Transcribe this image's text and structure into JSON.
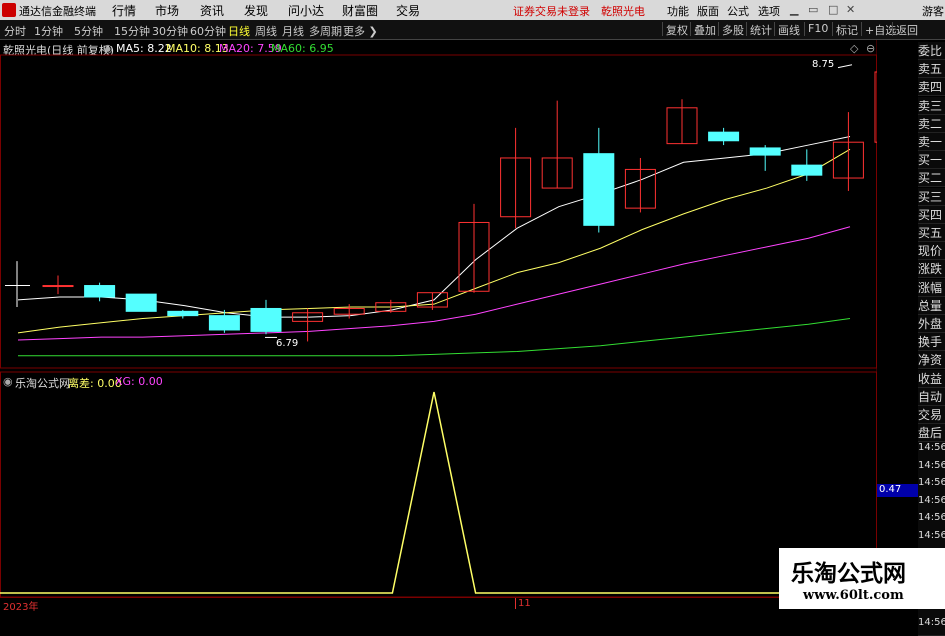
{
  "titlebar": {
    "app_name": "通达信金融终端",
    "menu": [
      "行情",
      "市场",
      "资讯",
      "发现",
      "问小达",
      "财富圈",
      "交易"
    ],
    "notice": "证券交易未登录",
    "stock_name": "乾照光电",
    "right_menu": [
      "功能",
      "版面",
      "公式",
      "选项"
    ],
    "guest": "游客"
  },
  "toolbar": {
    "periods": [
      "分时",
      "1分钟",
      "5分钟",
      "15分钟",
      "30分钟",
      "60分钟",
      "日线",
      "周线",
      "月线",
      "多周期",
      "更多"
    ],
    "active_period": "日线",
    "right_buttons": [
      "复权",
      "叠加",
      "多股",
      "统计",
      "画线",
      "F10",
      "标记",
      "+自选",
      "返回"
    ]
  },
  "main_chart": {
    "title": "乾照光电(日线 前复权)",
    "ma": [
      {
        "label": "MA5: 8.22",
        "color": "#ffffff"
      },
      {
        "label": "MA10: 8.13",
        "color": "#ffff66"
      },
      {
        "label": "MA20: 7.59",
        "color": "#ff44ff"
      },
      {
        "label": "MA60: 6.95",
        "color": "#33dd33"
      }
    ],
    "high_label": "8.75",
    "low_label": "6.79"
  },
  "sub_chart": {
    "title": "乐淘公式网",
    "values": [
      {
        "label": "离差: 0.00",
        "color": "#ffff66"
      },
      {
        "label": "XG: 0.00",
        "color": "#ff44ff"
      }
    ],
    "current_value": "0.47"
  },
  "right_panel": {
    "items": [
      "委比",
      "卖五",
      "卖四",
      "卖三",
      "卖二",
      "卖一",
      "买一",
      "买二",
      "买三",
      "买四",
      "买五",
      "现价",
      "涨跌",
      "涨幅",
      "总量",
      "外盘",
      "换手",
      "净资",
      "收益",
      "自动",
      "交易",
      "盘后",
      "14:56",
      "14:56",
      "14:56",
      "14:56",
      "14:56",
      "14:56",
      "14:56",
      "14:56",
      "14:56",
      "14:56",
      "14:56"
    ]
  },
  "watermark": {
    "title": "乐淘公式网",
    "url": "www.60lt.com"
  },
  "dates": {
    "start": "2023年",
    "mid": "11"
  },
  "chart_data": [
    {
      "type": "candlestick",
      "title": "乾照光电(日线 前复权)",
      "ylim": [
        6.7,
        8.8
      ],
      "yticks": [
        "8.60",
        "8.40",
        "8.20",
        "8.00",
        "7.80",
        "7.60",
        "7.40",
        "7.20",
        "7.00",
        "6.80"
      ],
      "yvals": [
        8.6,
        8.4,
        8.2,
        8.0,
        7.8,
        7.6,
        7.4,
        7.2,
        7.0,
        6.8
      ],
      "candles": [
        {
          "o": 7.18,
          "c": 7.18,
          "h": 7.25,
          "l": 7.12
        },
        {
          "o": 7.18,
          "c": 7.1,
          "h": 7.2,
          "l": 7.07
        },
        {
          "o": 7.12,
          "c": 7.0,
          "h": 7.12,
          "l": 7.0
        },
        {
          "o": 7.0,
          "c": 6.97,
          "h": 7.01,
          "l": 6.95
        },
        {
          "o": 6.97,
          "c": 6.87,
          "h": 7.01,
          "l": 6.85
        },
        {
          "o": 7.02,
          "c": 6.86,
          "h": 7.08,
          "l": 6.84
        },
        {
          "o": 6.93,
          "c": 6.99,
          "h": 7.02,
          "l": 6.79
        },
        {
          "o": 6.98,
          "c": 7.02,
          "h": 7.05,
          "l": 6.95
        },
        {
          "o": 7.0,
          "c": 7.06,
          "h": 7.08,
          "l": 6.99
        },
        {
          "o": 7.03,
          "c": 7.13,
          "h": 7.13,
          "l": 7.01
        },
        {
          "o": 7.14,
          "c": 7.62,
          "h": 7.75,
          "l": 7.13
        },
        {
          "o": 7.66,
          "c": 8.07,
          "h": 8.28,
          "l": 7.58
        },
        {
          "o": 7.86,
          "c": 8.07,
          "h": 8.47,
          "l": 7.86
        },
        {
          "o": 8.1,
          "c": 7.6,
          "h": 8.28,
          "l": 7.55
        },
        {
          "o": 7.72,
          "c": 7.99,
          "h": 8.07,
          "l": 7.69
        },
        {
          "o": 8.17,
          "c": 8.42,
          "h": 8.48,
          "l": 8.17
        },
        {
          "o": 8.25,
          "c": 8.19,
          "h": 8.28,
          "l": 8.16
        },
        {
          "o": 8.14,
          "c": 8.09,
          "h": 8.16,
          "l": 7.98
        },
        {
          "o": 8.02,
          "c": 7.95,
          "h": 8.13,
          "l": 7.91
        },
        {
          "o": 7.93,
          "c": 8.18,
          "h": 8.39,
          "l": 7.84
        },
        {
          "o": 8.18,
          "c": 8.67,
          "h": 8.75,
          "l": 8.07
        }
      ],
      "series": [
        {
          "name": "MA5",
          "color": "#ffffff",
          "values": [
            7.08,
            7.1,
            7.1,
            7.08,
            7.04,
            6.99,
            6.96,
            6.96,
            6.97,
            7.01,
            7.08,
            7.36,
            7.58,
            7.73,
            7.82,
            7.92,
            8.04,
            8.07,
            8.1,
            8.16,
            8.22
          ]
        },
        {
          "name": "MA10",
          "color": "#ffff66",
          "values": [
            6.85,
            6.89,
            6.92,
            6.95,
            6.97,
            6.99,
            7.01,
            7.02,
            7.03,
            7.03,
            7.05,
            7.16,
            7.27,
            7.34,
            7.44,
            7.57,
            7.68,
            7.78,
            7.86,
            7.96,
            8.13
          ]
        },
        {
          "name": "MA20",
          "color": "#ff44ff",
          "values": [
            6.8,
            6.81,
            6.82,
            6.82,
            6.83,
            6.84,
            6.85,
            6.86,
            6.88,
            6.9,
            6.93,
            6.98,
            7.05,
            7.12,
            7.19,
            7.26,
            7.33,
            7.39,
            7.45,
            7.51,
            7.59
          ]
        },
        {
          "name": "MA60",
          "color": "#33dd33",
          "values": [
            6.69,
            6.69,
            6.69,
            6.69,
            6.69,
            6.69,
            6.69,
            6.69,
            6.69,
            6.69,
            6.7,
            6.71,
            6.72,
            6.74,
            6.76,
            6.79,
            6.82,
            6.85,
            6.88,
            6.91,
            6.95
          ]
        }
      ]
    },
    {
      "type": "line",
      "title": "乐淘公式网",
      "ylim": [
        0,
        1.05
      ],
      "yticks": [
        "1.00",
        "0.80",
        "0.60",
        "0.40",
        "0.20"
      ],
      "yvals": [
        1.0,
        0.8,
        0.6,
        0.4,
        0.2
      ],
      "series": [
        {
          "name": "离差",
          "color": "#ffff66",
          "values": [
            0,
            0,
            0,
            0,
            0,
            0,
            0,
            0,
            0,
            0,
            1.0,
            0,
            0,
            0,
            0,
            0,
            0,
            0,
            0,
            0,
            0
          ]
        }
      ]
    }
  ]
}
